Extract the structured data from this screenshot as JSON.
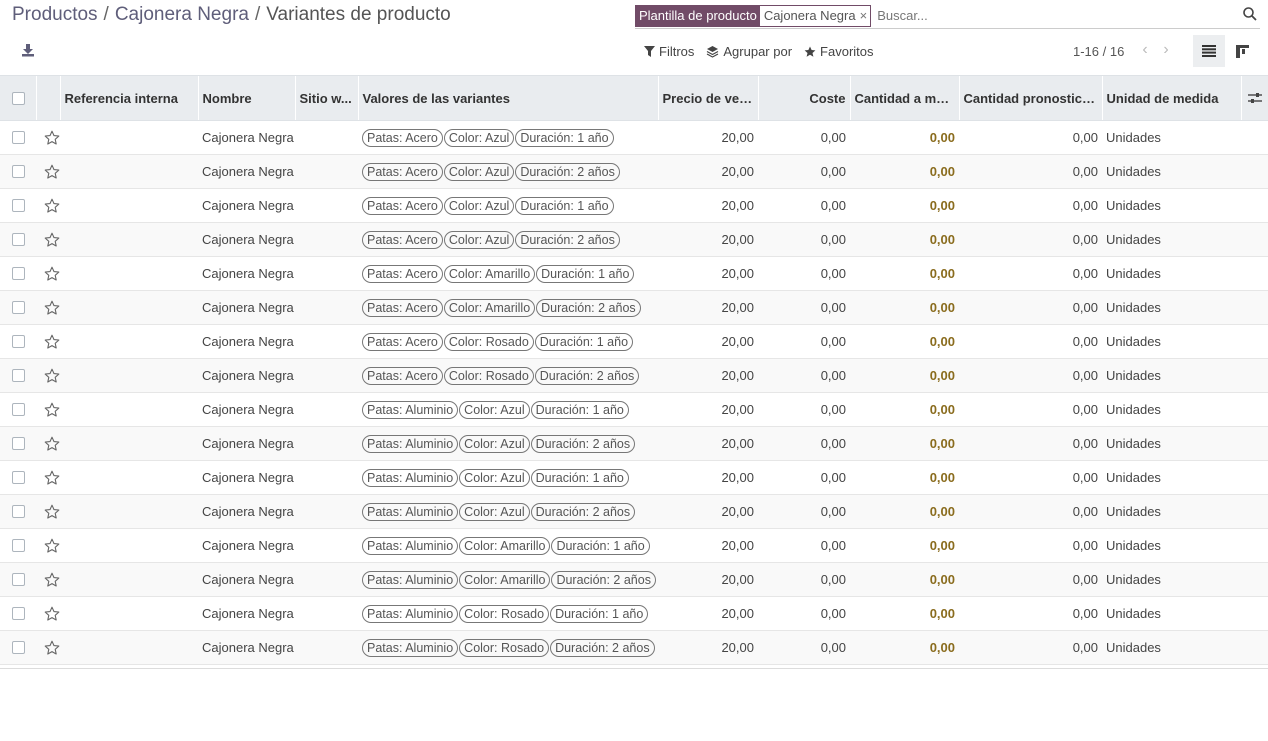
{
  "breadcrumb": {
    "items": [
      "Productos",
      "Cajonera Negra"
    ],
    "current": "Variantes de producto"
  },
  "search": {
    "facet_label": "Plantilla de producto",
    "facet_value": "Cajonera Negra",
    "facet_remove": "×",
    "placeholder": "Buscar..."
  },
  "filters": {
    "filters_label": "Filtros",
    "group_label": "Agrupar por",
    "favorites_label": "Favoritos"
  },
  "pager": {
    "value": "1-16 / 16",
    "prev": "‹",
    "next": "›"
  },
  "columns": {
    "ref": "Referencia interna",
    "name": "Nombre",
    "website": "Sitio w...",
    "variants": "Valores de las variantes",
    "sale_price": "Precio de venta",
    "cost": "Coste",
    "qty_onhand": "Cantidad a mano",
    "qty_forecast": "Cantidad pronosticada",
    "uom": "Unidad de medida"
  },
  "rows": [
    {
      "name": "Cajonera Negra",
      "tags": [
        "Patas: Acero",
        "Color: Azul",
        "Duración: 1 año"
      ],
      "price": "20,00",
      "cost": "0,00",
      "onhand": "0,00",
      "forecast": "0,00",
      "uom": "Unidades"
    },
    {
      "name": "Cajonera Negra",
      "tags": [
        "Patas: Acero",
        "Color: Azul",
        "Duración: 2 años"
      ],
      "price": "20,00",
      "cost": "0,00",
      "onhand": "0,00",
      "forecast": "0,00",
      "uom": "Unidades"
    },
    {
      "name": "Cajonera Negra",
      "tags": [
        "Patas: Acero",
        "Color: Azul",
        "Duración: 1 año"
      ],
      "price": "20,00",
      "cost": "0,00",
      "onhand": "0,00",
      "forecast": "0,00",
      "uom": "Unidades"
    },
    {
      "name": "Cajonera Negra",
      "tags": [
        "Patas: Acero",
        "Color: Azul",
        "Duración: 2 años"
      ],
      "price": "20,00",
      "cost": "0,00",
      "onhand": "0,00",
      "forecast": "0,00",
      "uom": "Unidades"
    },
    {
      "name": "Cajonera Negra",
      "tags": [
        "Patas: Acero",
        "Color: Amarillo",
        "Duración: 1 año"
      ],
      "price": "20,00",
      "cost": "0,00",
      "onhand": "0,00",
      "forecast": "0,00",
      "uom": "Unidades"
    },
    {
      "name": "Cajonera Negra",
      "tags": [
        "Patas: Acero",
        "Color: Amarillo",
        "Duración: 2 años"
      ],
      "price": "20,00",
      "cost": "0,00",
      "onhand": "0,00",
      "forecast": "0,00",
      "uom": "Unidades"
    },
    {
      "name": "Cajonera Negra",
      "tags": [
        "Patas: Acero",
        "Color: Rosado",
        "Duración: 1 año"
      ],
      "price": "20,00",
      "cost": "0,00",
      "onhand": "0,00",
      "forecast": "0,00",
      "uom": "Unidades"
    },
    {
      "name": "Cajonera Negra",
      "tags": [
        "Patas: Acero",
        "Color: Rosado",
        "Duración: 2 años"
      ],
      "price": "20,00",
      "cost": "0,00",
      "onhand": "0,00",
      "forecast": "0,00",
      "uom": "Unidades"
    },
    {
      "name": "Cajonera Negra",
      "tags": [
        "Patas: Aluminio",
        "Color: Azul",
        "Duración: 1 año"
      ],
      "price": "20,00",
      "cost": "0,00",
      "onhand": "0,00",
      "forecast": "0,00",
      "uom": "Unidades"
    },
    {
      "name": "Cajonera Negra",
      "tags": [
        "Patas: Aluminio",
        "Color: Azul",
        "Duración: 2 años"
      ],
      "price": "20,00",
      "cost": "0,00",
      "onhand": "0,00",
      "forecast": "0,00",
      "uom": "Unidades"
    },
    {
      "name": "Cajonera Negra",
      "tags": [
        "Patas: Aluminio",
        "Color: Azul",
        "Duración: 1 año"
      ],
      "price": "20,00",
      "cost": "0,00",
      "onhand": "0,00",
      "forecast": "0,00",
      "uom": "Unidades"
    },
    {
      "name": "Cajonera Negra",
      "tags": [
        "Patas: Aluminio",
        "Color: Azul",
        "Duración: 2 años"
      ],
      "price": "20,00",
      "cost": "0,00",
      "onhand": "0,00",
      "forecast": "0,00",
      "uom": "Unidades"
    },
    {
      "name": "Cajonera Negra",
      "tags": [
        "Patas: Aluminio",
        "Color: Amarillo",
        "Duración: 1 año"
      ],
      "price": "20,00",
      "cost": "0,00",
      "onhand": "0,00",
      "forecast": "0,00",
      "uom": "Unidades"
    },
    {
      "name": "Cajonera Negra",
      "tags": [
        "Patas: Aluminio",
        "Color: Amarillo",
        "Duración: 2 años"
      ],
      "price": "20,00",
      "cost": "0,00",
      "onhand": "0,00",
      "forecast": "0,00",
      "uom": "Unidades"
    },
    {
      "name": "Cajonera Negra",
      "tags": [
        "Patas: Aluminio",
        "Color: Rosado",
        "Duración: 1 año"
      ],
      "price": "20,00",
      "cost": "0,00",
      "onhand": "0,00",
      "forecast": "0,00",
      "uom": "Unidades"
    },
    {
      "name": "Cajonera Negra",
      "tags": [
        "Patas: Aluminio",
        "Color: Rosado",
        "Duración: 2 años"
      ],
      "price": "20,00",
      "cost": "0,00",
      "onhand": "0,00",
      "forecast": "0,00",
      "uom": "Unidades"
    }
  ],
  "icons": {
    "download": "download-icon",
    "search": "search-icon",
    "filter": "filter-icon",
    "group": "layers-icon",
    "favorites": "star-icon",
    "list_view": "list-view-icon",
    "kanban_view": "kanban-view-icon",
    "optional_columns": "sliders-icon",
    "row_favorite": "star-outline-icon"
  },
  "colors": {
    "facet": "#714b67",
    "onhand": "#8a6c1e",
    "header_bg": "#e9ecef"
  }
}
